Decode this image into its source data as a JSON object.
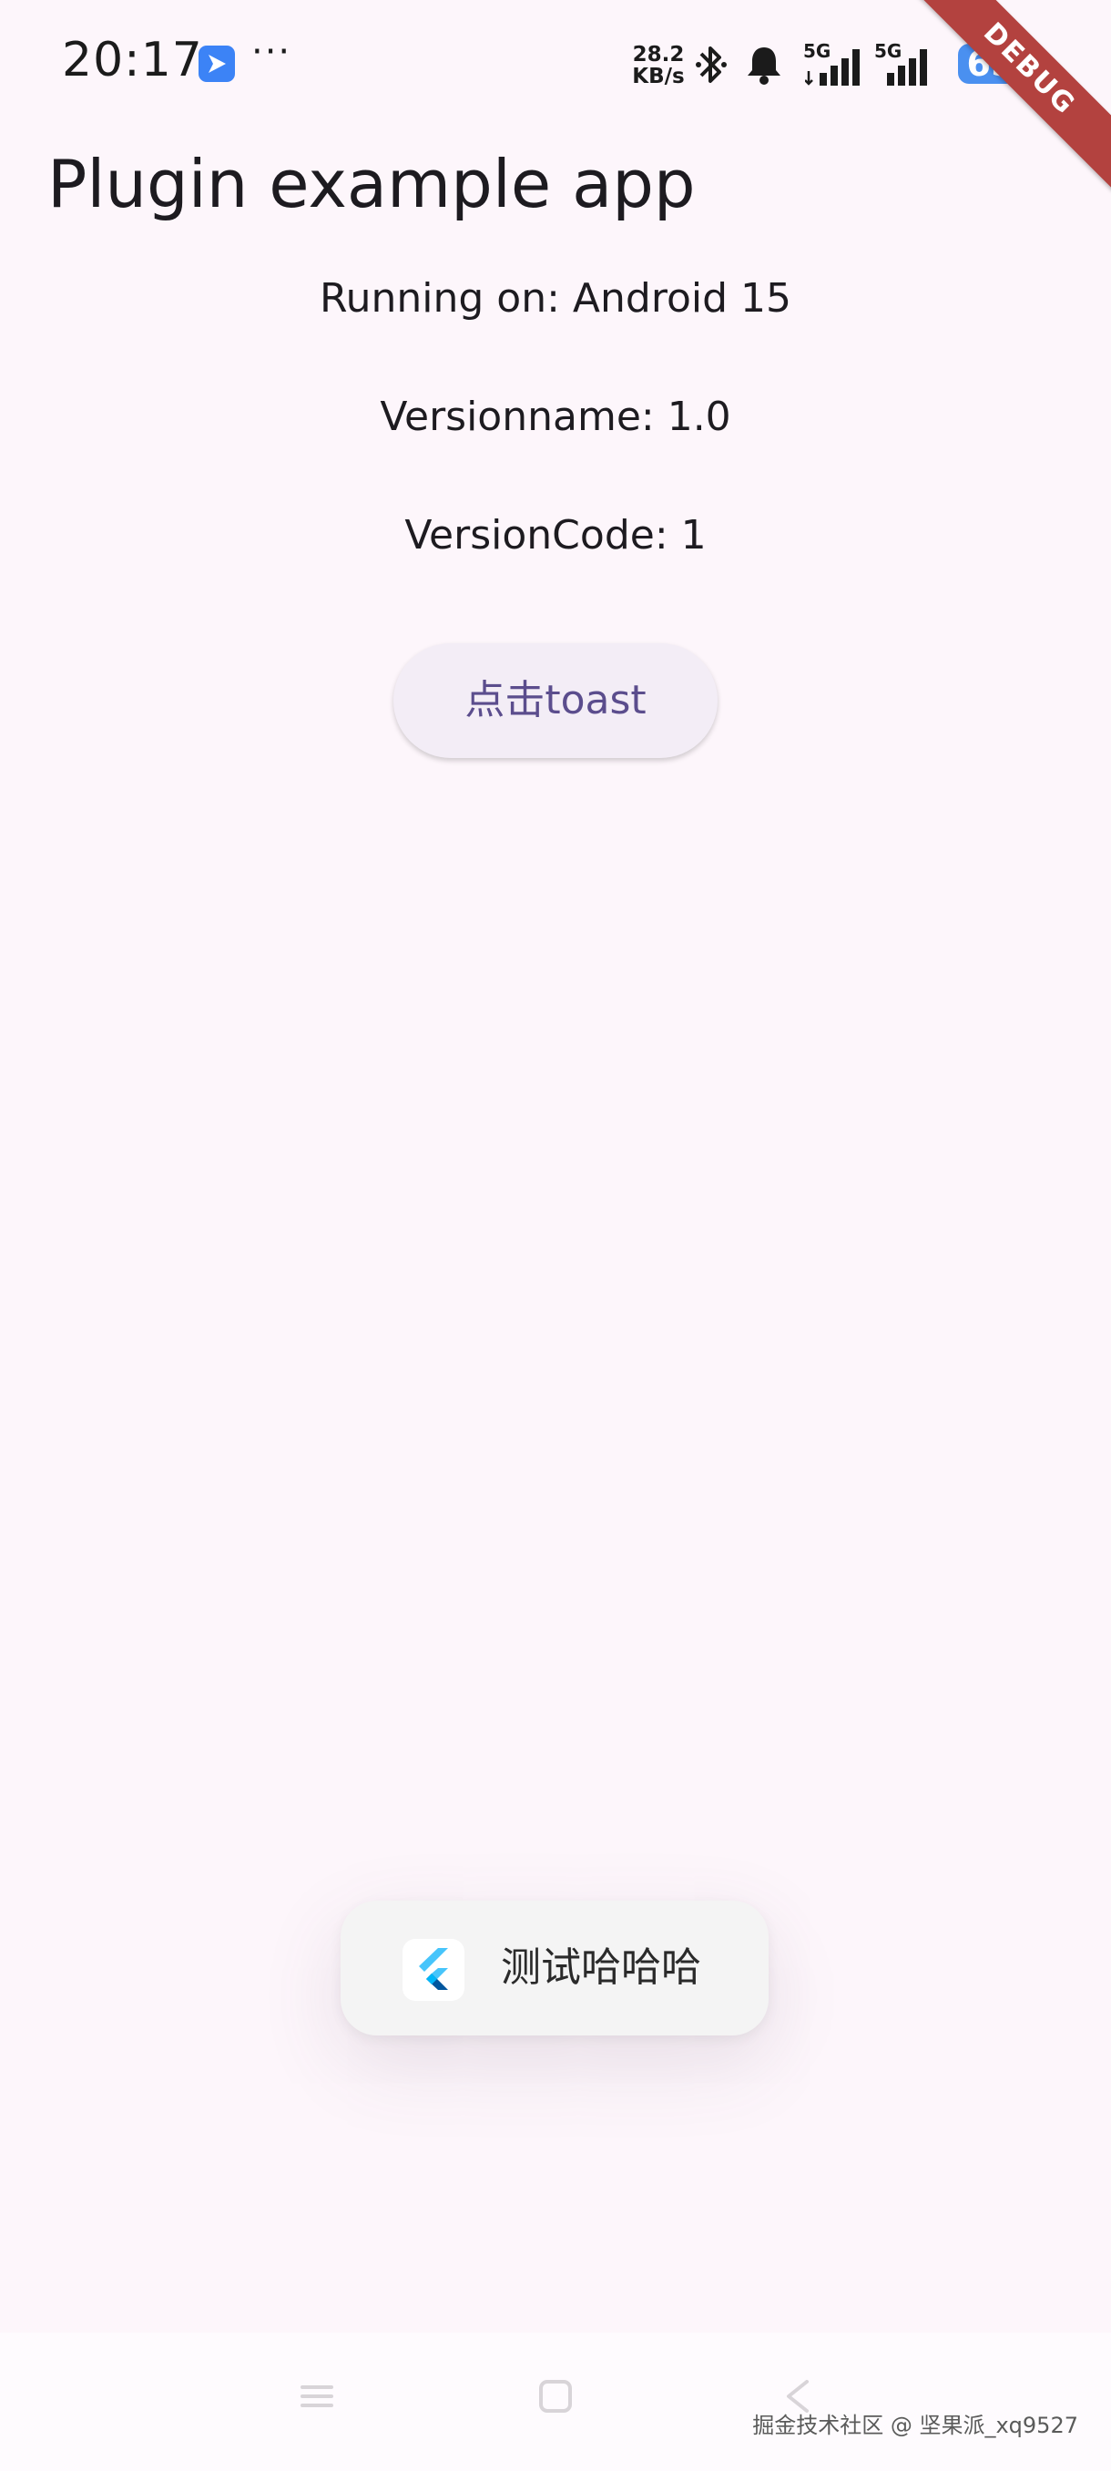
{
  "status_bar": {
    "time": "20:17",
    "more": "···",
    "speed_value": "28.2",
    "speed_unit": "KB/s",
    "network_1": "5G",
    "network_2": "5G",
    "battery": "65"
  },
  "debug_banner": "DEBUG",
  "app_bar": {
    "title": "Plugin example app"
  },
  "info": {
    "running_on": "Running on: Android 15",
    "version_name": "Versionname: 1.0",
    "version_code": "VersionCode: 1"
  },
  "actions": {
    "toast_button_label": "点击toast"
  },
  "toast": {
    "message": "测试哈哈哈"
  },
  "watermark": "掘金技术社区 @ 坚果派_xq9527",
  "colors": {
    "background": "#fdf6fb",
    "button_text": "#5b4d8d",
    "button_bg": "#f3edf6",
    "debug_banner": "#b3423f",
    "battery": "#4a90f0"
  }
}
